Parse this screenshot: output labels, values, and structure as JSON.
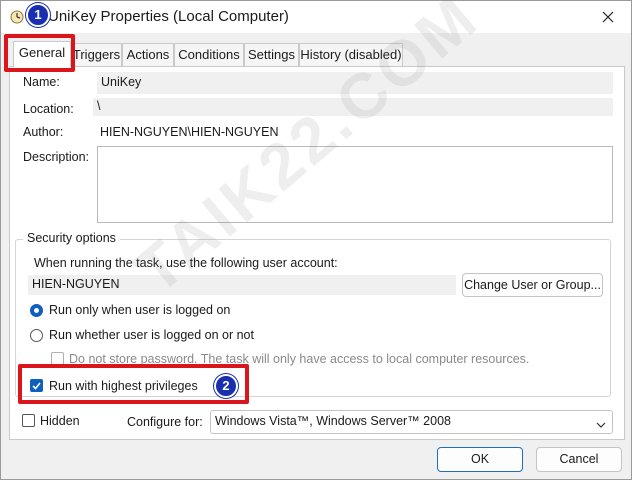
{
  "window": {
    "title": "UniKey Properties (Local Computer)"
  },
  "tabs": [
    {
      "label": "General",
      "active": true
    },
    {
      "label": "Triggers",
      "active": false
    },
    {
      "label": "Actions",
      "active": false
    },
    {
      "label": "Conditions",
      "active": false
    },
    {
      "label": "Settings",
      "active": false
    },
    {
      "label": "History (disabled)",
      "active": false
    }
  ],
  "general": {
    "name_label": "Name:",
    "name_value": "UniKey",
    "location_label": "Location:",
    "location_value": "\\",
    "author_label": "Author:",
    "author_value": "HIEN-NGUYEN\\HIEN-NGUYEN",
    "description_label": "Description:",
    "description_value": ""
  },
  "security": {
    "group_title": "Security options",
    "account_prompt": "When running the task, use the following user account:",
    "account_value": "HIEN-NGUYEN",
    "change_user_button": "Change User or Group...",
    "run_logged_on_label": "Run only when user is logged on",
    "run_logged_on_selected": true,
    "run_whether_label": "Run whether user is logged on or not",
    "run_whether_selected": false,
    "no_store_password_label": "Do not store password.  The task will only have access to local computer resources.",
    "no_store_password_checked": false,
    "highest_privileges_label": "Run with highest privileges",
    "highest_privileges_checked": true
  },
  "bottom": {
    "hidden_label": "Hidden",
    "hidden_checked": false,
    "configure_label": "Configure for:",
    "configure_value": "Windows Vista™, Windows Server™ 2008"
  },
  "buttons": {
    "ok": "OK",
    "cancel": "Cancel"
  },
  "annotations": {
    "marker_1": "1",
    "marker_2": "2"
  },
  "watermark": "TAIK22.COM",
  "colors": {
    "accent": "#0f5fbf",
    "highlight": "#d9161c",
    "marker": "#1a2fb0"
  },
  "icons": {
    "title": "task-clock-icon",
    "close": "close-icon",
    "chevron": "chevron-down-icon",
    "check": "check-icon"
  }
}
